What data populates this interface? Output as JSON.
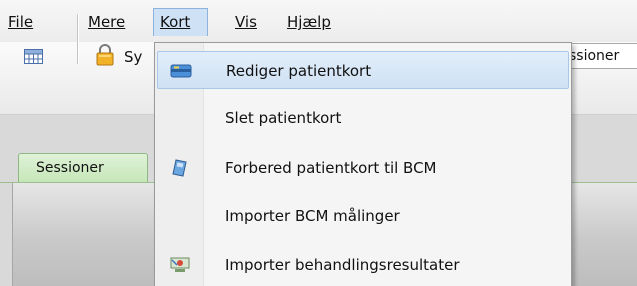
{
  "menubar": {
    "items": [
      {
        "label": "File",
        "accel_index": 0
      },
      {
        "label": "Mere",
        "accel_index": 0
      },
      {
        "label": "Kort",
        "accel_index": 0,
        "active": true
      },
      {
        "label": "Vis",
        "accel_index": 0
      },
      {
        "label": "Hjælp",
        "accel_index": 0
      }
    ]
  },
  "toolbar": {
    "partial_label": "Sy",
    "partial_input_text": "ssioner",
    "icons": [
      "grid-icon",
      "lock-icon"
    ]
  },
  "tabs": {
    "active_label": "Sessioner"
  },
  "dropdown": {
    "items": [
      {
        "label": "Rediger patientkort",
        "icon": "patient-card-icon",
        "highlighted": true
      },
      {
        "label": "Slet patientkort",
        "icon": null
      },
      {
        "label": "Forbered patientkort til BCM",
        "icon": "bcm-card-icon"
      },
      {
        "label": "Importer BCM målinger",
        "icon": null
      },
      {
        "label": "Importer behandlingsresultater",
        "icon": "treatment-results-icon"
      }
    ]
  },
  "colors": {
    "menu_highlight": "#cfe1f4",
    "item_highlight_border": "#a8c8ea",
    "tab_active": "#c5e6b7"
  }
}
